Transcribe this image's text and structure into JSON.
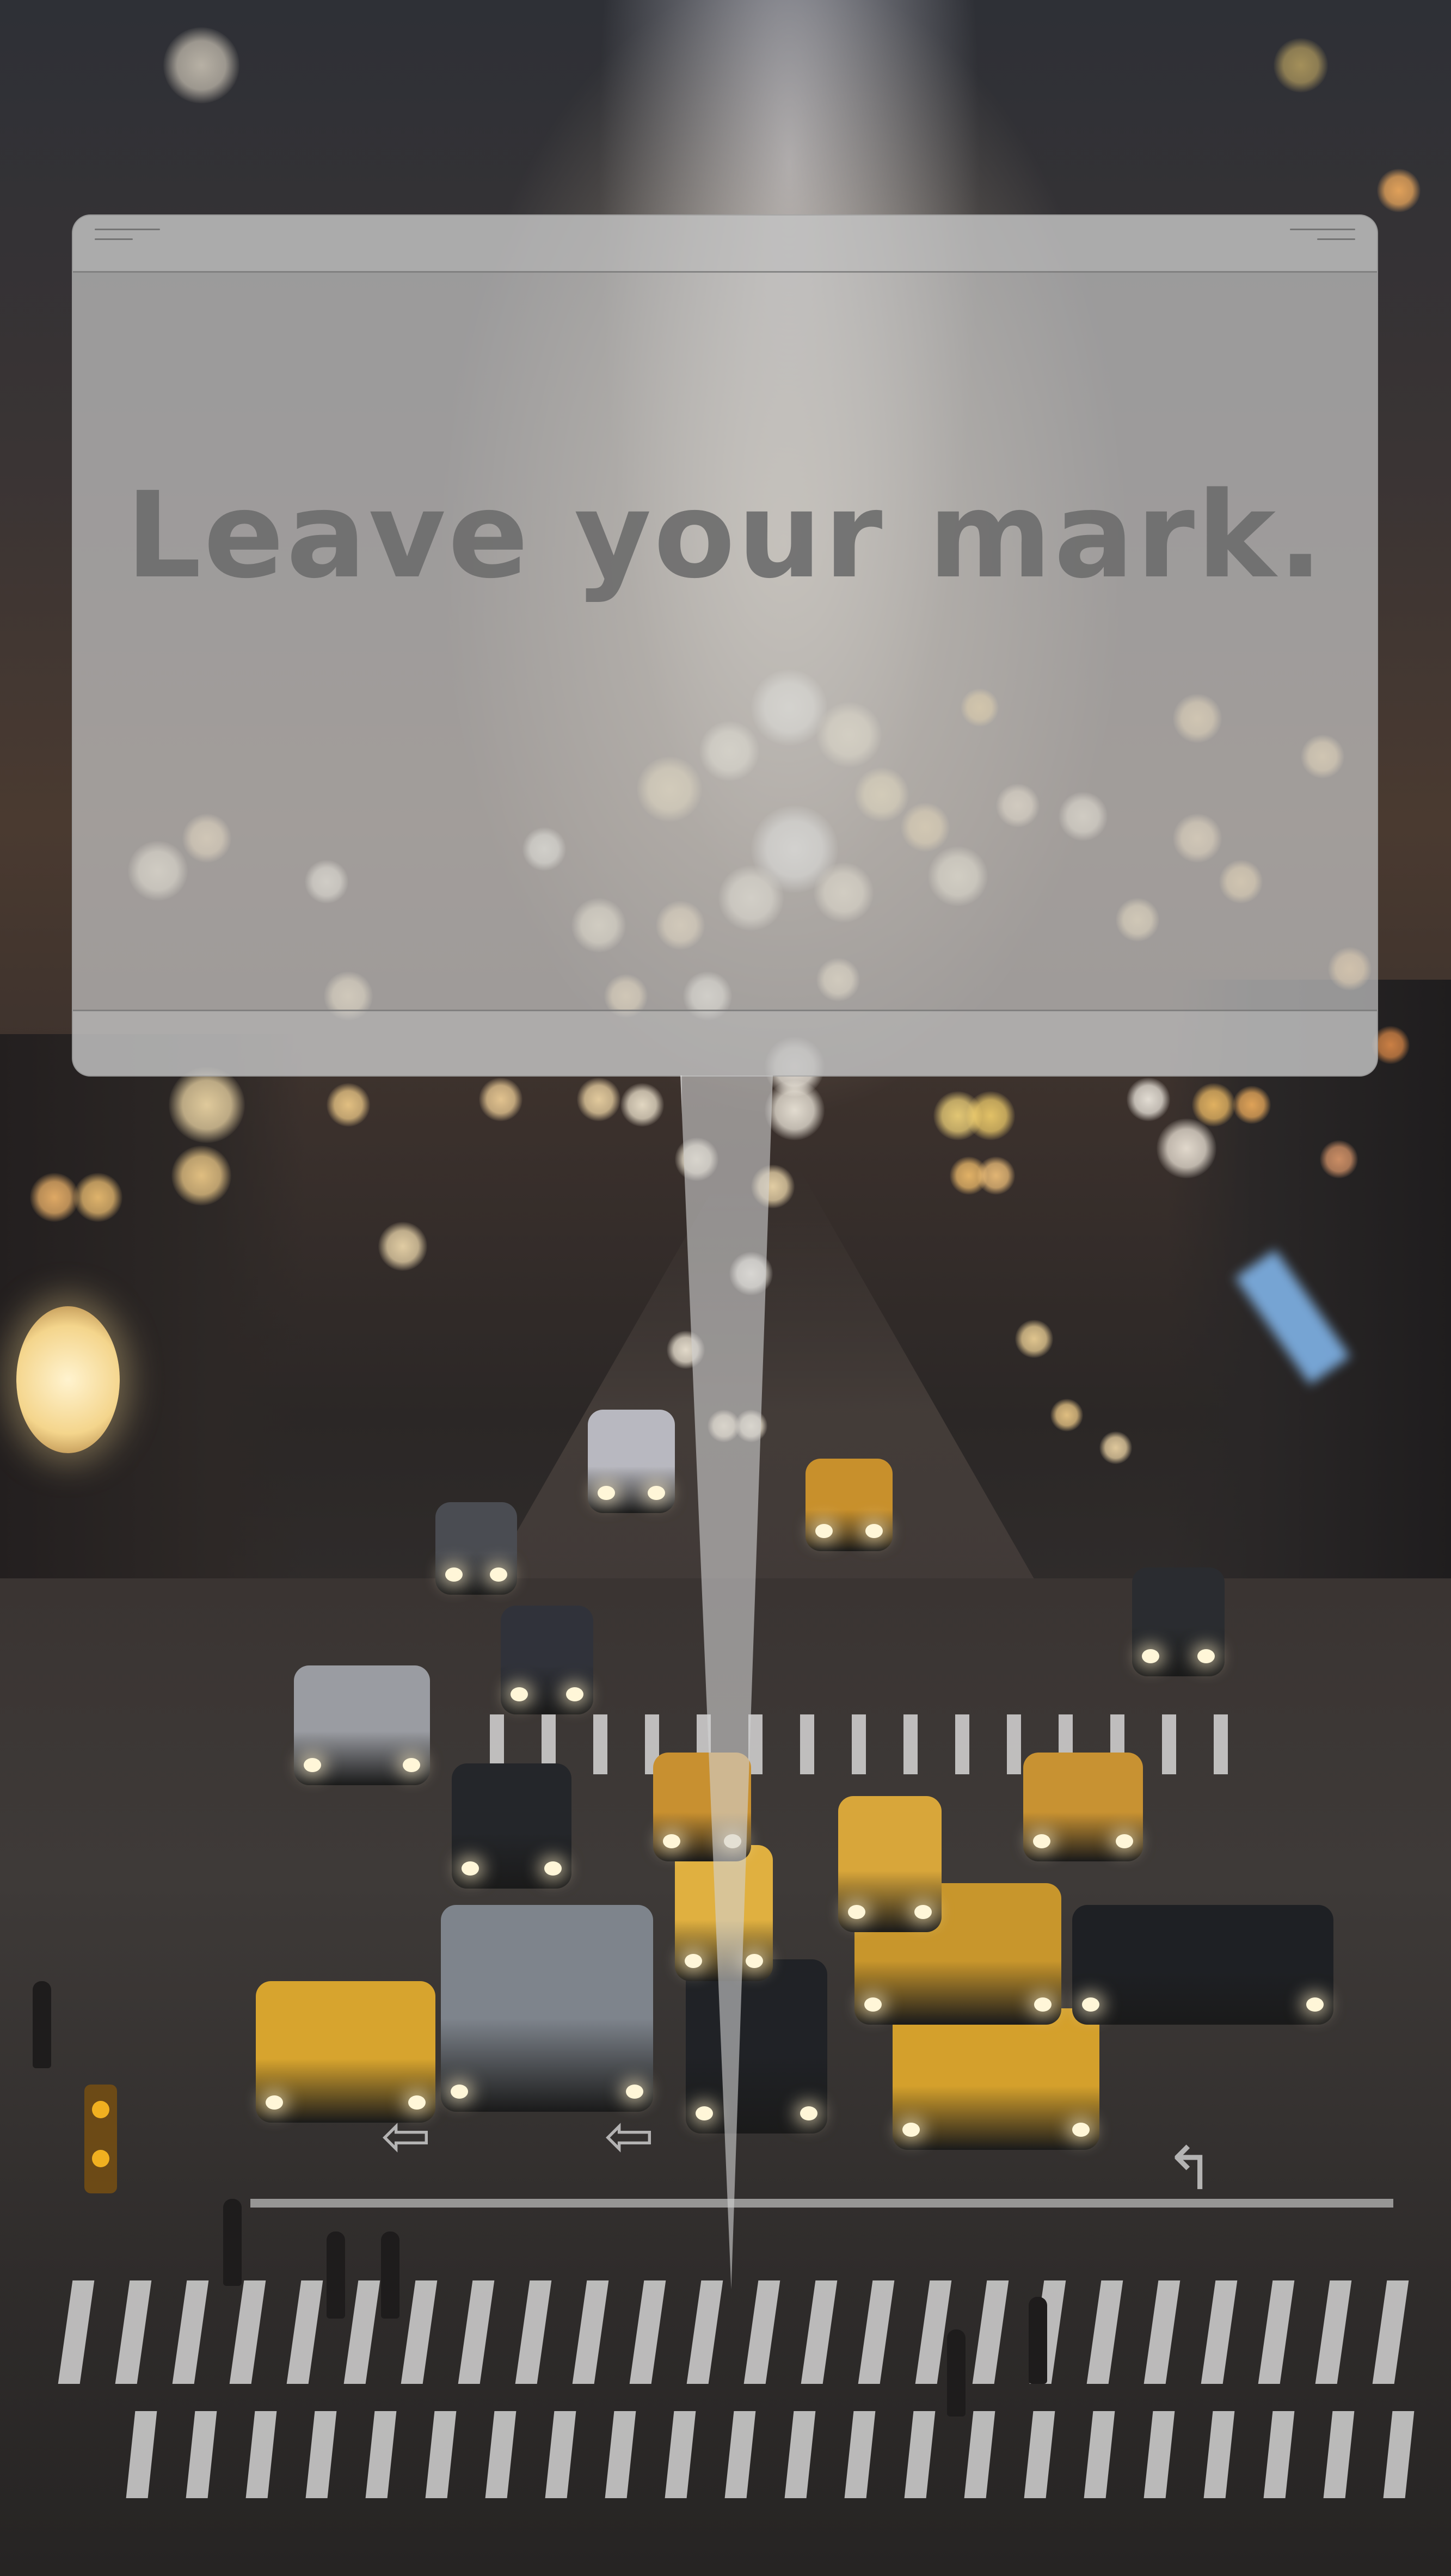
{
  "headline": "Leave your mark.",
  "colors": {
    "panel": "#c8c8c8",
    "headline_text": "#6e6e6e",
    "panel_border": "#969696"
  },
  "icons": {
    "left_grip": "grip-lines-icon",
    "right_grip": "grip-lines-icon"
  }
}
